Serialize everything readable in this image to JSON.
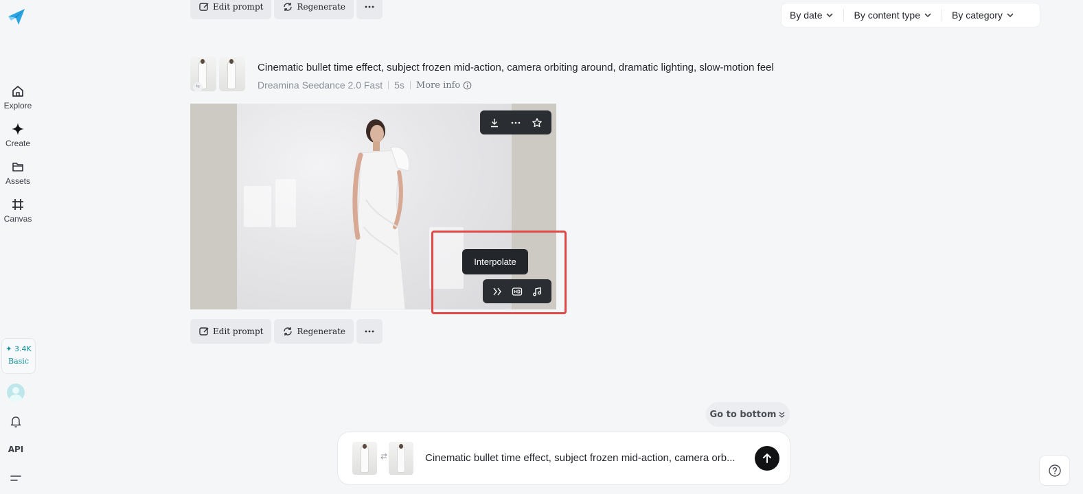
{
  "sidebar": {
    "items": [
      {
        "label": "Explore",
        "icon": "home-icon"
      },
      {
        "label": "Create",
        "icon": "sparkle-icon"
      },
      {
        "label": "Assets",
        "icon": "folder-icon"
      },
      {
        "label": "Canvas",
        "icon": "canvas-icon"
      }
    ],
    "credits": {
      "amount": "✦ 3.4K",
      "plan": "Basic"
    },
    "api_label": "API"
  },
  "filters": {
    "date": "By date",
    "content_type": "By content type",
    "category": "By category"
  },
  "actions": {
    "edit_prompt": "Edit prompt",
    "regenerate": "Regenerate"
  },
  "generation": {
    "prompt": "Cinematic bullet time effect, subject frozen mid-action, camera orbiting around, dramatic lighting, slow-motion feel",
    "model": "Dreamina Seedance 2.0 Fast",
    "duration": "5s",
    "more_info": "More info",
    "thumb_badge": "⇆"
  },
  "video": {
    "tooltip": "Interpolate",
    "top_tools": [
      "download-icon",
      "more-icon",
      "star-icon"
    ],
    "bottom_tools": [
      "interpolate-icon",
      "hd-upscale-icon",
      "music-icon"
    ]
  },
  "go_to_bottom": "Go to bottom",
  "composer": {
    "text": "Cinematic bullet time effect, subject frozen mid-action, camera orb..."
  },
  "colors": {
    "accent_teal": "#138f9a",
    "highlight_red": "#e04848",
    "toolbar_dark": "#2a2d31"
  }
}
